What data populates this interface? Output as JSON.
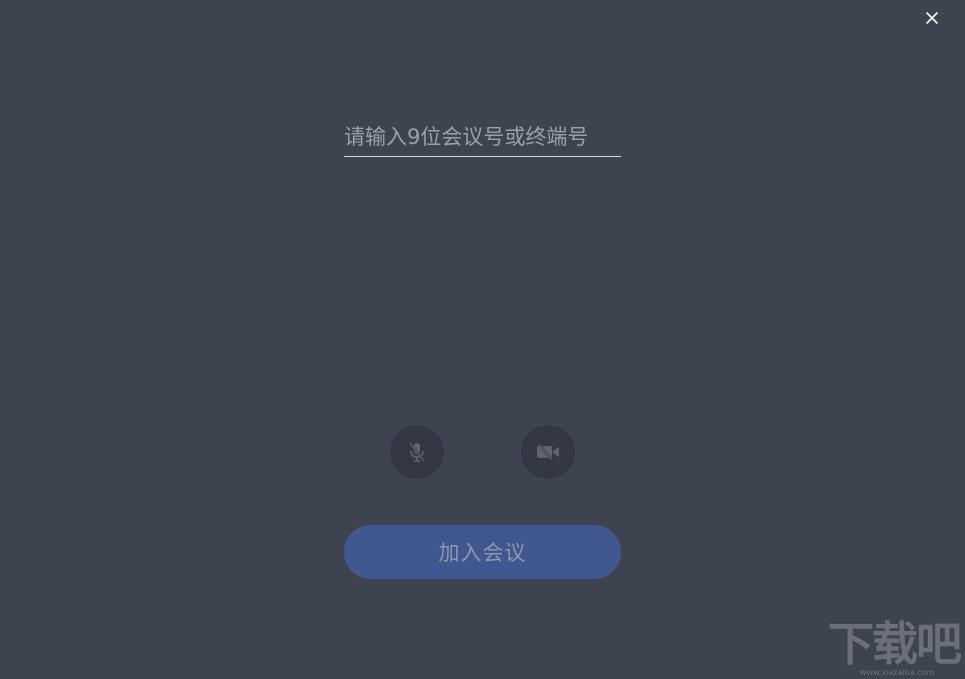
{
  "join_dialog": {
    "meeting_input": {
      "placeholder": "请输入9位会议号或终端号",
      "value": ""
    },
    "mic_toggle": {
      "icon": "mic-off-icon",
      "state": "off"
    },
    "camera_toggle": {
      "icon": "camera-off-icon",
      "state": "off"
    },
    "join_label": "加入会议",
    "close_icon": "close-icon"
  },
  "watermark": {
    "text": "下载吧",
    "url_text": "www.xiazaiba.com"
  },
  "colors": {
    "background": "#3e4350",
    "round_button": "#343842",
    "join_button": "#41578f",
    "join_text": "#8d97ad",
    "placeholder": "#9aa0ab"
  }
}
